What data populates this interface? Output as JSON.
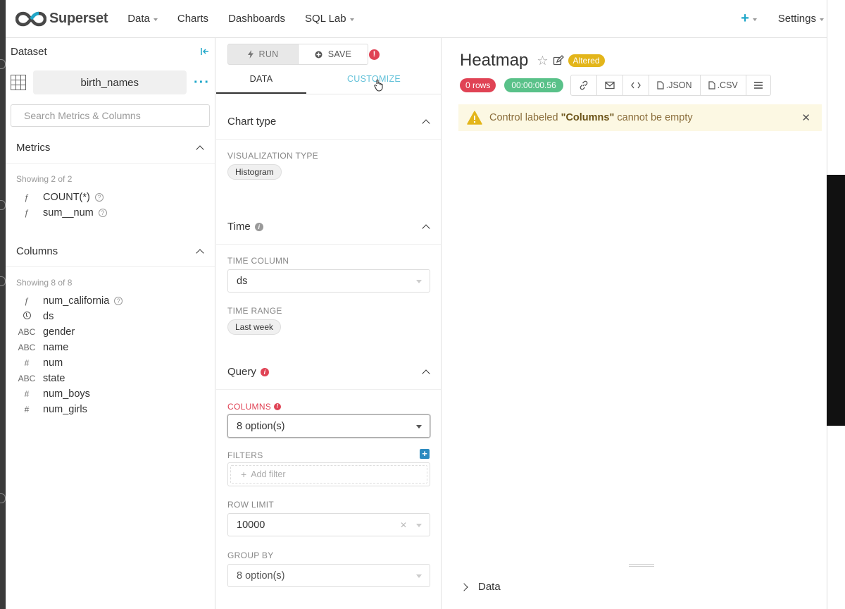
{
  "nav": {
    "brand": "Superset",
    "items": [
      {
        "label": "Data",
        "caret": true
      },
      {
        "label": "Charts",
        "caret": false
      },
      {
        "label": "Dashboards",
        "caret": false
      },
      {
        "label": "SQL Lab",
        "caret": true
      }
    ],
    "settings_label": "Settings",
    "accent": "#20a7c9"
  },
  "dataset": {
    "header": "Dataset",
    "name": "birth_names",
    "search_placeholder": "Search Metrics & Columns",
    "metrics": {
      "title": "Metrics",
      "showing": "Showing 2 of 2",
      "items": [
        {
          "type": "ƒ",
          "name": "COUNT(*)",
          "help": true
        },
        {
          "type": "ƒ",
          "name": "sum__num",
          "help": true
        }
      ]
    },
    "columns": {
      "title": "Columns",
      "showing": "Showing 8 of 8",
      "items": [
        {
          "type": "ƒ",
          "name": "num_california",
          "help": true
        },
        {
          "type": "clock",
          "name": "ds",
          "help": false
        },
        {
          "type": "ABC",
          "name": "gender",
          "help": false
        },
        {
          "type": "ABC",
          "name": "name",
          "help": false
        },
        {
          "type": "#",
          "name": "num",
          "help": false
        },
        {
          "type": "ABC",
          "name": "state",
          "help": false
        },
        {
          "type": "#",
          "name": "num_boys",
          "help": false
        },
        {
          "type": "#",
          "name": "num_girls",
          "help": false
        }
      ]
    }
  },
  "controls": {
    "run_label": "RUN",
    "save_label": "SAVE",
    "tabs": {
      "data": "DATA",
      "customize": "CUSTOMIZE"
    },
    "chart_type": {
      "title": "Chart type",
      "viz_label": "VISUALIZATION TYPE",
      "viz_value": "Histogram"
    },
    "time": {
      "title": "Time",
      "column_label": "TIME COLUMN",
      "column_value": "ds",
      "range_label": "TIME RANGE",
      "range_value": "Last week"
    },
    "query": {
      "title": "Query",
      "columns_label": "COLUMNS",
      "columns_value": "8 option(s)",
      "filters_label": "FILTERS",
      "add_filter": "Add filter",
      "row_limit_label": "ROW LIMIT",
      "row_limit_value": "10000",
      "group_by_label": "GROUP BY",
      "group_by_value": "8 option(s)"
    }
  },
  "chart": {
    "title": "Heatmap",
    "altered": "Altered",
    "rows": "0 rows",
    "duration": "00:00:00.56",
    "json_label": ".JSON",
    "csv_label": ".CSV",
    "warning_prefix": "Control labeled ",
    "warning_field": "\"Columns\"",
    "warning_suffix": " cannot be empty",
    "data_toggle": "Data"
  },
  "colors": {
    "error": "#e04355",
    "success": "#59c189",
    "warning_bg": "#fcf8e3",
    "altered": "#e3b51a"
  }
}
